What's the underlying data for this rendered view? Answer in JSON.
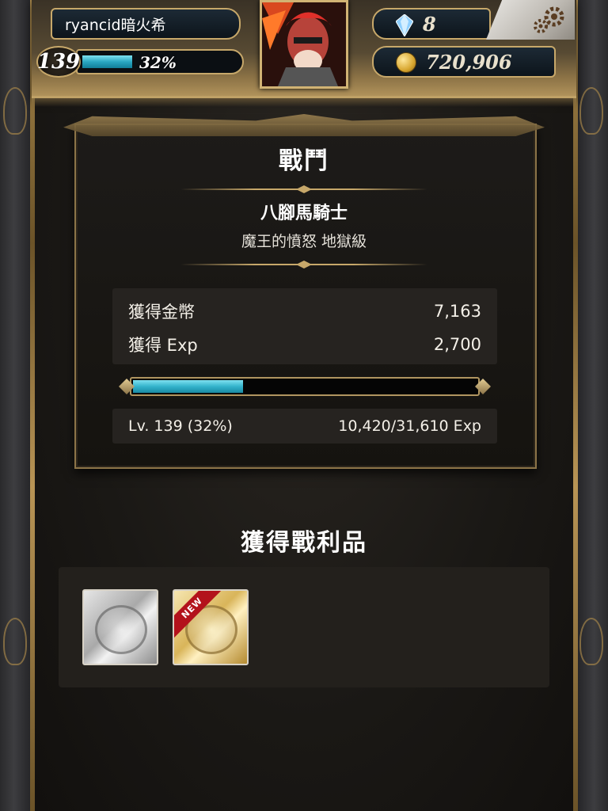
{
  "player": {
    "name": "ryancid暗火希",
    "level": "139",
    "exp_percent_label": "32%",
    "exp_fraction": 0.32,
    "gems": "8",
    "gold": "720,906"
  },
  "battle": {
    "title": "戰鬥",
    "boss_name": "八腳馬騎士",
    "stage": "魔王的憤怒 地獄級",
    "rewards": [
      {
        "label": "獲得金幣",
        "value": "7,163"
      },
      {
        "label": "獲得 Exp",
        "value": "2,700"
      }
    ],
    "level_label": "Lv. 139 (32%)",
    "exp_label": "10,420/31,610 Exp",
    "progress_fraction": 0.32
  },
  "loot": {
    "title": "獲得戰利品",
    "items": [
      {
        "kind": "silver-medal-card",
        "is_new": false
      },
      {
        "kind": "gold-medal-card",
        "is_new": true,
        "badge": "NEW"
      }
    ]
  },
  "icons": {
    "gem": "gem-icon",
    "coin": "coin-icon",
    "settings": "gears-icon"
  },
  "colors": {
    "accent_bar": "#2aa7c2",
    "frame_gold": "#c7a86a",
    "new_ribbon": "#b3121b"
  }
}
